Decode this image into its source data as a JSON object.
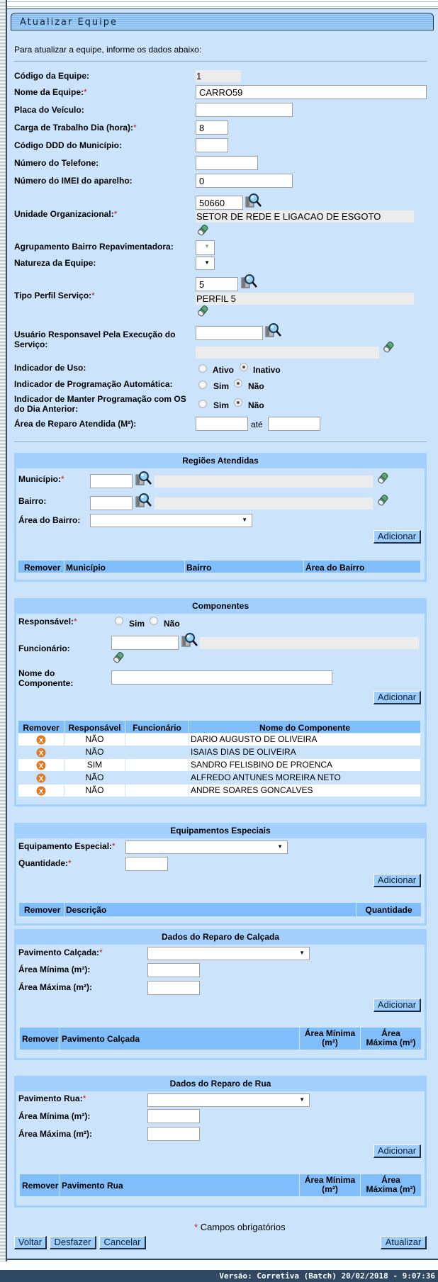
{
  "title": "Atualizar Equipe",
  "intro": "Para atualizar a equipe, informe os dados abaixo:",
  "required_mark": "*",
  "form": {
    "codigo": {
      "label": "Código da Equipe:",
      "value": "1"
    },
    "nome": {
      "label": "Nome da Equipe:",
      "value": "CARRO59"
    },
    "placa": {
      "label": "Placa do Veículo:",
      "value": ""
    },
    "carga": {
      "label": "Carga de Trabalho Dia (hora):",
      "value": "8"
    },
    "ddd": {
      "label": "Código DDD do Município:",
      "value": ""
    },
    "telefone": {
      "label": "Número do Telefone:",
      "value": ""
    },
    "imei": {
      "label": "Número do IMEI do aparelho:",
      "value": "0"
    },
    "unidade": {
      "label": "Unidade Organizacional:",
      "code": "50660",
      "description": "SETOR DE REDE E LIGACAO DE ESGOTO"
    },
    "agrupamento": {
      "label": "Agrupamento Bairro Repavimentadora:"
    },
    "natureza": {
      "label": "Natureza da Equipe:"
    },
    "tipo_perfil": {
      "label": "Tipo Perfil Serviço:",
      "code": "5",
      "description": "PERFIL 5"
    },
    "usuario": {
      "label_line1": "Usuário Responsavel Pela Execução do",
      "label_line2": "Serviço:",
      "code": "",
      "description": ""
    },
    "indicador_uso": {
      "label": "Indicador de Uso:",
      "options": [
        "Ativo",
        "Inativo"
      ],
      "selected": "Inativo"
    },
    "prog_auto": {
      "label": "Indicador de Programação Automática:",
      "options": [
        "Sim",
        "Não"
      ],
      "selected": "Não"
    },
    "manter_prog": {
      "label_line1": "Indicador de Manter Programação com OS",
      "label_line2": "do Dia Anterior:",
      "options": [
        "Sim",
        "Não"
      ],
      "selected": "Não"
    },
    "area_reparo": {
      "label": "Área de Reparo Atendida (M²):",
      "between": "até",
      "from": "",
      "to": ""
    }
  },
  "regioes": {
    "title": "Regiões Atendidas",
    "municipio_label": "Município:",
    "bairro_label": "Bairro:",
    "area_label": "Área do Bairro:",
    "add": "Adicionar",
    "columns": [
      "Remover",
      "Município",
      "Bairro",
      "Área do Bairro"
    ]
  },
  "componentes": {
    "title": "Componentes",
    "responsavel_label": "Responsável:",
    "responsavel_options": [
      "Sim",
      "Não"
    ],
    "funcionario_label": "Funcionário:",
    "nome_label_line1": "Nome do",
    "nome_label_line2": "Componente:",
    "add": "Adicionar",
    "columns": [
      "Remover",
      "Responsável",
      "Funcionário",
      "Nome do Componente"
    ],
    "rows": [
      {
        "responsavel": "NÃO",
        "funcionario": "",
        "nome": "DARIO AUGUSTO DE OLIVEIRA"
      },
      {
        "responsavel": "NÃO",
        "funcionario": "",
        "nome": "ISAIAS DIAS DE OLIVEIRA"
      },
      {
        "responsavel": "SIM",
        "funcionario": "",
        "nome": "SANDRO FELISBINO DE PROENCA"
      },
      {
        "responsavel": "NÃO",
        "funcionario": "",
        "nome": "ALFREDO ANTUNES MOREIRA NETO"
      },
      {
        "responsavel": "NÃO",
        "funcionario": "",
        "nome": "ANDRE SOARES GONCALVES"
      }
    ]
  },
  "equipamentos": {
    "title": "Equipamentos Especiais",
    "equip_label": "Equipamento Especial:",
    "qtd_label": "Quantidade:",
    "add": "Adicionar",
    "columns": [
      "Remover",
      "Descrição",
      "Quantidade"
    ]
  },
  "calcada": {
    "title": "Dados do Reparo de Calçada",
    "pav_label": "Pavimento Calçada:",
    "min_label": "Área Mínima (m²):",
    "max_label": "Área Máxima (m²):",
    "add": "Adicionar",
    "columns": [
      "Remover",
      "Pavimento Calçada",
      "Área Mínima (m²)",
      "Área Máxima (m²)"
    ]
  },
  "rua": {
    "title": "Dados do Reparo de Rua",
    "pav_label": "Pavimento Rua:",
    "min_label": "Área Mínima (m²):",
    "max_label": "Área Máxima (m²):",
    "add": "Adicionar",
    "columns": [
      "Remover",
      "Pavimento Rua",
      "Área Mínima (m²)",
      "Área Máxima (m²)"
    ]
  },
  "required_note": "Campos obrigatórios",
  "buttons": {
    "voltar": "Voltar",
    "desfazer": "Desfazer",
    "cancelar": "Cancelar",
    "atualizar": "Atualizar"
  },
  "footer": "Versão: Corretiva (Batch) 20/02/2018 - 9:07:36",
  "colors": {
    "panel": "#cbe4fc",
    "section": "#a4d0fd",
    "table_header": "#80bdfb",
    "footer": "#2f4962",
    "required": "#d0141e",
    "remove_icon": "#e07a22"
  }
}
